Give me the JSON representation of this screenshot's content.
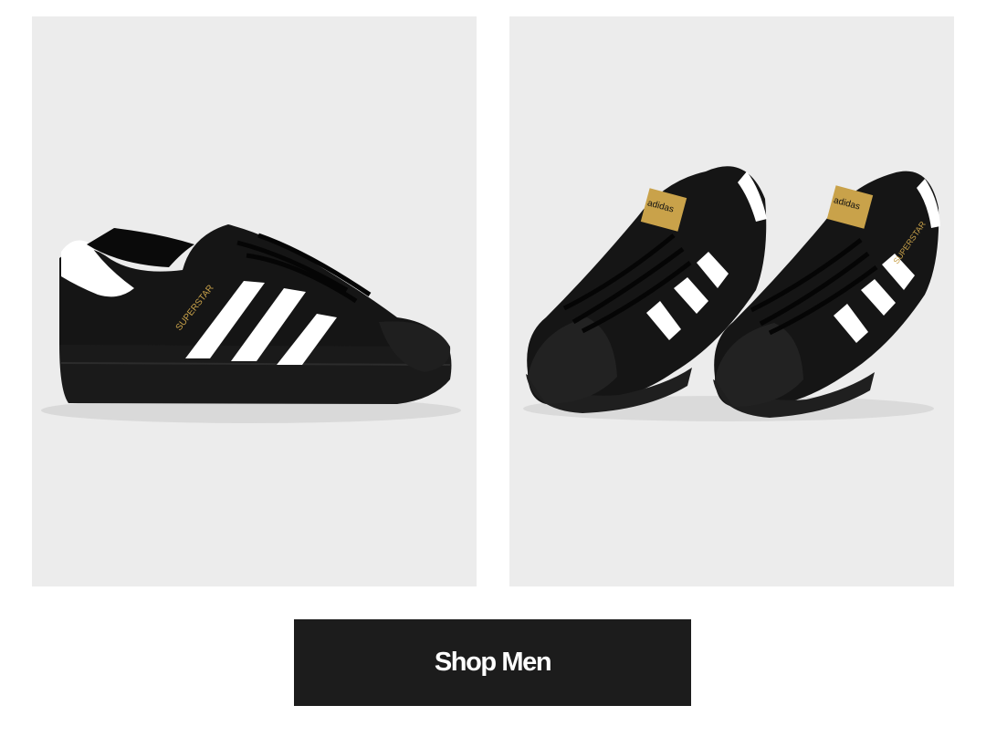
{
  "products": [
    {
      "image": "sneaker-side-view",
      "shoe_color": "#111111",
      "stripe_color": "#ffffff",
      "model_text": "SUPERSTAR",
      "model_text_color": "#c9a24a"
    },
    {
      "image": "sneaker-pair-front-view",
      "shoe_color": "#111111",
      "stripe_color": "#ffffff",
      "tongue_label": "adidas",
      "tongue_label_color": "#c9a24a",
      "model_text": "SUPERSTAR"
    }
  ],
  "cta": {
    "label": "Shop Men",
    "background": "#1c1c1c",
    "text_color": "#ffffff"
  },
  "colors": {
    "page_background": "#ffffff",
    "tile_background": "#ececec"
  }
}
